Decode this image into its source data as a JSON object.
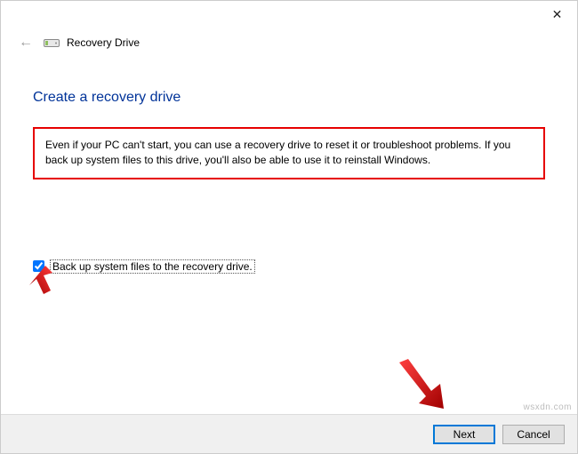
{
  "window": {
    "close_glyph": "✕"
  },
  "header": {
    "back_glyph": "←",
    "title": "Recovery Drive"
  },
  "page": {
    "heading": "Create a recovery drive",
    "description": "Even if your PC can't start, you can use a recovery drive to reset it or troubleshoot problems. If you back up system files to this drive, you'll also be able to use it to reinstall Windows."
  },
  "checkbox": {
    "label": "Back up system files to the recovery drive.",
    "checked": true
  },
  "footer": {
    "next_label": "Next",
    "cancel_label": "Cancel"
  },
  "watermark": "wsxdn.com",
  "colors": {
    "highlight_border": "#e60000",
    "heading": "#003399",
    "primary_border": "#0078d7"
  }
}
